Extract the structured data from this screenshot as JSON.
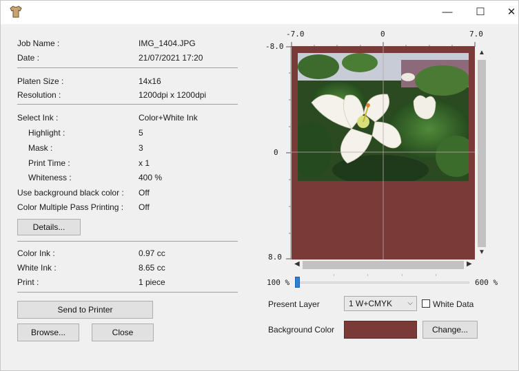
{
  "titlebar": {
    "icons": {
      "app": "shirt-icon",
      "minimize": "minimize-icon",
      "maximize": "maximize-icon",
      "close": "close-icon"
    },
    "minimize_glyph": "—",
    "maximize_glyph": "☐",
    "close_glyph": "✕"
  },
  "job": {
    "job_name_label": "Job Name :",
    "job_name": "IMG_1404.JPG",
    "date_label": "Date :",
    "date": "21/07/2021 17:20"
  },
  "platen": {
    "size_label": "Platen Size :",
    "size": "14x16",
    "resolution_label": "Resolution :",
    "resolution": "1200dpi x 1200dpi"
  },
  "ink": {
    "select_label": "Select Ink :",
    "select": "Color+White Ink",
    "highlight_label": "Highlight :",
    "highlight": "5",
    "mask_label": "Mask :",
    "mask": "3",
    "print_time_label": "Print Time :",
    "print_time": "x 1",
    "whiteness_label": "Whiteness :",
    "whiteness": "400 %",
    "bg_black_label": "Use background black color :",
    "bg_black": "Off",
    "multi_pass_label": "Color Multiple Pass Printing :",
    "multi_pass": "Off",
    "details_button": "Details..."
  },
  "usage": {
    "color_ink_label": "Color Ink :",
    "color_ink": "0.97 cc",
    "white_ink_label": "White Ink :",
    "white_ink": "8.65 cc",
    "print_label": "Print :",
    "print": "1 piece"
  },
  "actions": {
    "send": "Send to Printer",
    "browse": "Browse...",
    "close": "Close"
  },
  "preview": {
    "ruler_x_left": "-7.0",
    "ruler_x_center": "0",
    "ruler_x_right": "7.0",
    "ruler_y_top": "-8.0",
    "ruler_y_center": "0",
    "ruler_y_bottom": "8.0",
    "background_color": "#7a3a38"
  },
  "zoom": {
    "min_label": "100 %",
    "max_label": "600 %",
    "value_fraction": 0.0
  },
  "layer": {
    "present_label": "Present Layer",
    "selected": "1  W+CMYK",
    "white_data_label": "White Data",
    "white_data_checked": false
  },
  "background": {
    "label": "Background Color",
    "change_button": "Change..."
  }
}
